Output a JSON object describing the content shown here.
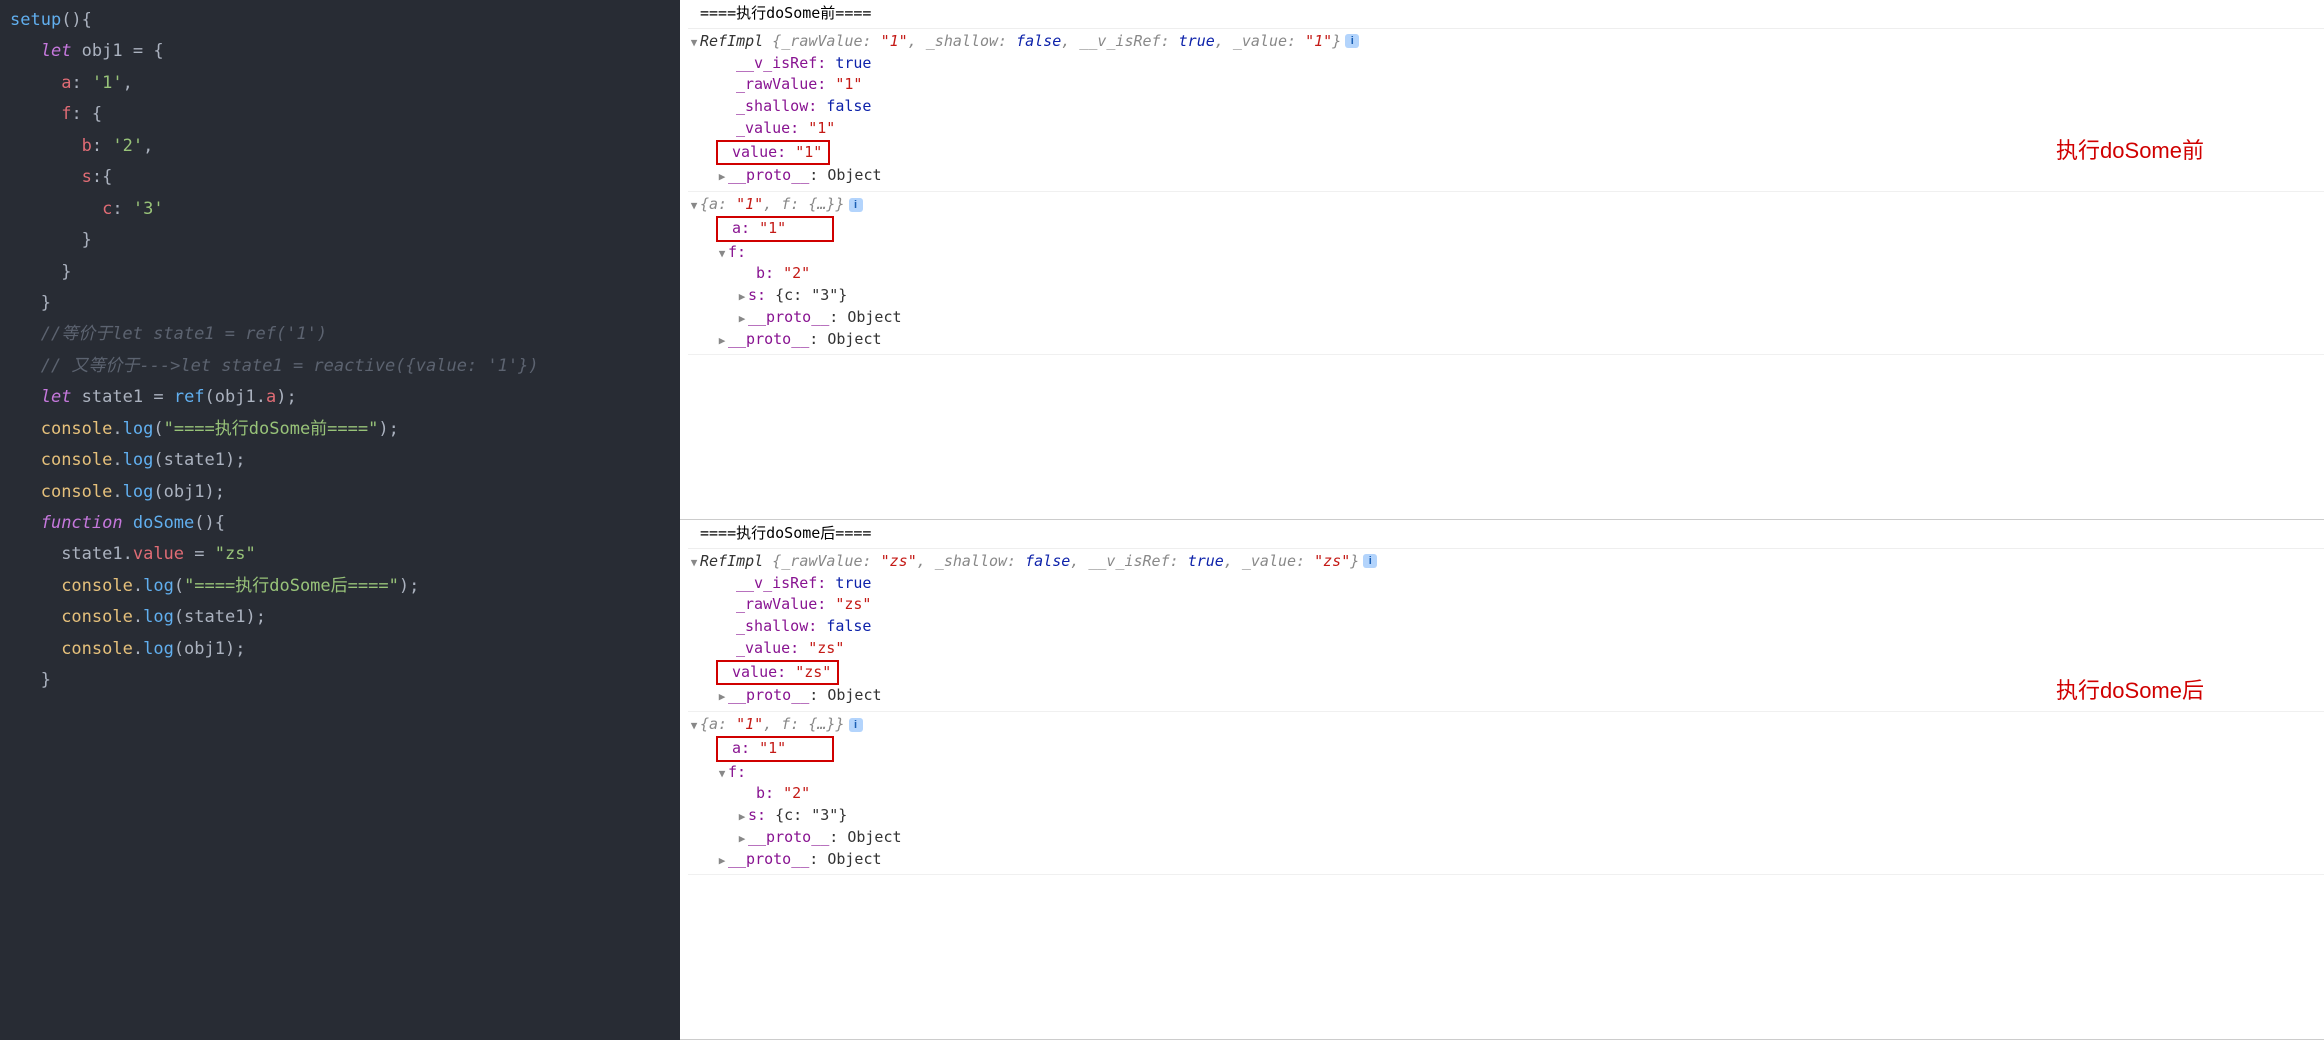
{
  "code": {
    "l1": {
      "a": "setup",
      "b": "(){"
    },
    "l2": {
      "a": "let",
      "b": " obj1 ",
      "c": "=",
      "d": " {"
    },
    "l3": {
      "a": "a",
      "b": ":",
      "c": " '1'",
      "d": ","
    },
    "l4": {
      "a": "f",
      "b": ":",
      "c": " {"
    },
    "l5": {
      "a": "b",
      "b": ":",
      "c": " '2'",
      "d": ","
    },
    "l6": {
      "a": "s",
      "b": ":{"
    },
    "l7": {
      "a": "c",
      "b": ":",
      "c": " '3'"
    },
    "l8": "}",
    "l9": "}",
    "l10": "}",
    "l11": "//等价于let state1 = ref('1')",
    "l12": "// 又等价于--->let state1 = reactive({value: '1'})",
    "l13": {
      "a": "let",
      "b": " state1 ",
      "c": "=",
      "d": " ",
      "e": "ref",
      "f": "(obj1.",
      "g": "a",
      "h": ");"
    },
    "l14": {
      "a": "console",
      "b": ".",
      "c": "log",
      "d": "(",
      "e": "\"====执行doSome前====\"",
      "f": ");"
    },
    "l15": {
      "a": "console",
      "b": ".",
      "c": "log",
      "d": "(state1);"
    },
    "l16": {
      "a": "console",
      "b": ".",
      "c": "log",
      "d": "(obj1);"
    },
    "l17": {
      "a": "function",
      "b": " ",
      "c": "doSome",
      "d": "(){"
    },
    "l18": {
      "a": "state1.",
      "b": "value",
      "c": " = ",
      "d": "\"zs\""
    },
    "l19": {
      "a": "console",
      "b": ".",
      "c": "log",
      "d": "(",
      "e": "\"====执行doSome后====\"",
      "f": ");"
    },
    "l20": {
      "a": "console",
      "b": ".",
      "c": "log",
      "d": "(state1);"
    },
    "l21": {
      "a": "console",
      "b": ".",
      "c": "log",
      "d": "(obj1);"
    },
    "l22": "}"
  },
  "console_before": {
    "header": "====执行doSome前====",
    "ref_summary": {
      "class": "RefImpl ",
      "open": "{",
      "p1": "_rawValue: ",
      "v1": "\"1\"",
      "p2": ", _shallow: ",
      "v2": "false",
      "p3": ", __v_isRef: ",
      "v3": "true",
      "p4": ", _value: ",
      "v4": "\"1\"",
      "close": "}"
    },
    "ref_props": {
      "isRef_k": "__v_isRef: ",
      "isRef_v": "true",
      "raw_k": "_rawValue: ",
      "raw_v": "\"1\"",
      "shallow_k": "_shallow: ",
      "shallow_v": "false",
      "ival_k": "_value: ",
      "ival_v": "\"1\"",
      "val_k": "value: ",
      "val_v": "\"1\"",
      "proto_k": "__proto__",
      "proto_v": ": Object"
    },
    "obj_summary": {
      "open": "{",
      "p1": "a: ",
      "v1": "\"1\"",
      "p2": ", f: ",
      "v2": "{…}",
      "close": "}"
    },
    "obj_props": {
      "a_k": "a: ",
      "a_v": "\"1\"",
      "f_k": "f:",
      "b_k": "b: ",
      "b_v": "\"2\"",
      "s_k": "s: ",
      "s_v": "{c: \"3\"}",
      "fproto_k": "__proto__",
      "fproto_v": ": Object",
      "proto_k": "__proto__",
      "proto_v": ": Object"
    },
    "annotation": "执行doSome前"
  },
  "console_after": {
    "header": "====执行doSome后====",
    "ref_summary": {
      "class": "RefImpl ",
      "open": "{",
      "p1": "_rawValue: ",
      "v1": "\"zs\"",
      "p2": ", _shallow: ",
      "v2": "false",
      "p3": ", __v_isRef: ",
      "v3": "true",
      "p4": ", _value: ",
      "v4": "\"zs\"",
      "close": "}"
    },
    "ref_props": {
      "isRef_k": "__v_isRef: ",
      "isRef_v": "true",
      "raw_k": "_rawValue: ",
      "raw_v": "\"zs\"",
      "shallow_k": "_shallow: ",
      "shallow_v": "false",
      "ival_k": "_value: ",
      "ival_v": "\"zs\"",
      "val_k": "value: ",
      "val_v": "\"zs\"",
      "proto_k": "__proto__",
      "proto_v": ": Object"
    },
    "obj_summary": {
      "open": "{",
      "p1": "a: ",
      "v1": "\"1\"",
      "p2": ", f: ",
      "v2": "{…}",
      "close": "}"
    },
    "obj_props": {
      "a_k": "a: ",
      "a_v": "\"1\"",
      "f_k": "f:",
      "b_k": "b: ",
      "b_v": "\"2\"",
      "s_k": "s: ",
      "s_v": "{c: \"3\"}",
      "fproto_k": "__proto__",
      "fproto_v": ": Object",
      "proto_k": "__proto__",
      "proto_v": ": Object"
    },
    "annotation": "执行doSome后"
  },
  "icons": {
    "info": "i",
    "down": "▼",
    "right": "▶"
  }
}
